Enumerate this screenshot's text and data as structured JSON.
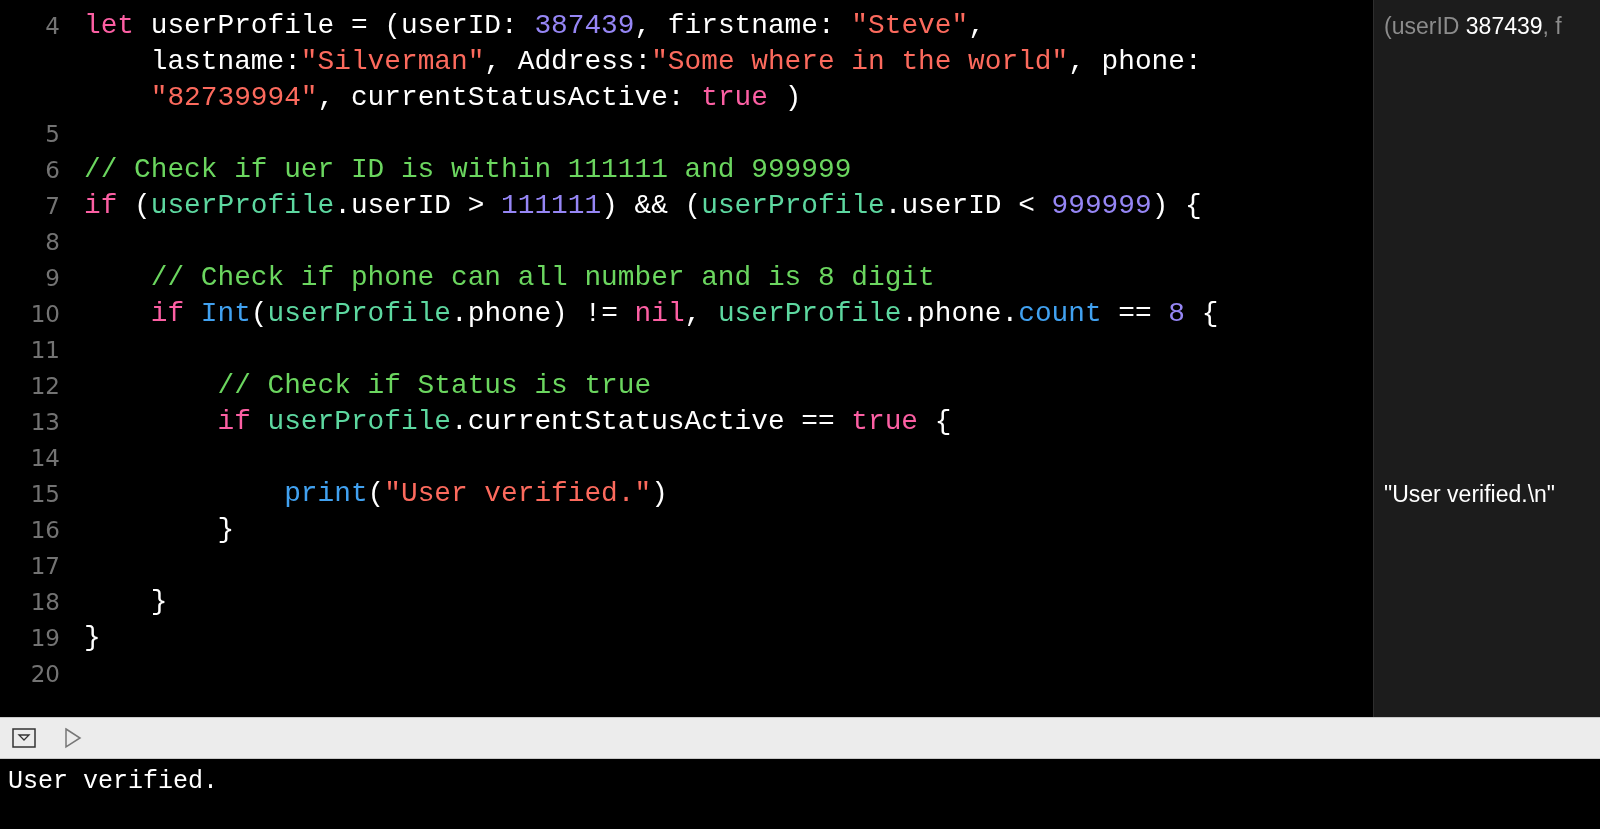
{
  "editor": {
    "lines": [
      {
        "number": "4",
        "tokens": [
          {
            "kind": "keyword",
            "text": "let"
          },
          {
            "kind": "plain",
            "text": " userProfile = (userID: "
          },
          {
            "kind": "number",
            "text": "387439"
          },
          {
            "kind": "plain",
            "text": ", firstname: "
          },
          {
            "kind": "string",
            "text": "\"Steve\""
          },
          {
            "kind": "plain",
            "text": ","
          }
        ],
        "result": [
          {
            "kind": "label",
            "text": "(userID "
          },
          {
            "kind": "value",
            "text": "387439"
          },
          {
            "kind": "label",
            "text": ", f"
          }
        ]
      },
      {
        "tokens": [
          {
            "kind": "plain",
            "text": "    lastname:"
          },
          {
            "kind": "string",
            "text": "\"Silverman\""
          },
          {
            "kind": "plain",
            "text": ", Address:"
          },
          {
            "kind": "string",
            "text": "\"Some where in the world\""
          },
          {
            "kind": "plain",
            "text": ", phone:"
          }
        ]
      },
      {
        "tokens": [
          {
            "kind": "string",
            "text": "    \"82739994\""
          },
          {
            "kind": "plain",
            "text": ", currentStatusActive: "
          },
          {
            "kind": "keyword",
            "text": "true"
          },
          {
            "kind": "plain",
            "text": " )"
          }
        ]
      },
      {
        "number": "5"
      },
      {
        "number": "6",
        "tokens": [
          {
            "kind": "comment",
            "text": "// Check if uer ID is within 111111 and 999999"
          }
        ]
      },
      {
        "number": "7",
        "tokens": [
          {
            "kind": "keyword",
            "text": "if"
          },
          {
            "kind": "plain",
            "text": " ("
          },
          {
            "kind": "ident",
            "text": "userProfile"
          },
          {
            "kind": "plain",
            "text": ".userID > "
          },
          {
            "kind": "number",
            "text": "111111"
          },
          {
            "kind": "plain",
            "text": ") && ("
          },
          {
            "kind": "ident",
            "text": "userProfile"
          },
          {
            "kind": "plain",
            "text": ".userID < "
          },
          {
            "kind": "number",
            "text": "999999"
          },
          {
            "kind": "plain",
            "text": ") {"
          }
        ]
      },
      {
        "number": "8"
      },
      {
        "number": "9",
        "tokens": [
          {
            "kind": "comment",
            "text": "    // Check if phone can all number and is 8 digit"
          }
        ]
      },
      {
        "number": "10",
        "tokens": [
          {
            "kind": "keyword",
            "text": "    if"
          },
          {
            "kind": "type",
            "text": " Int"
          },
          {
            "kind": "plain",
            "text": "("
          },
          {
            "kind": "ident",
            "text": "userProfile"
          },
          {
            "kind": "plain",
            "text": ".phone) != "
          },
          {
            "kind": "keyword",
            "text": "nil"
          },
          {
            "kind": "plain",
            "text": ", "
          },
          {
            "kind": "ident",
            "text": "userProfile"
          },
          {
            "kind": "plain",
            "text": ".phone."
          },
          {
            "kind": "type",
            "text": "count"
          },
          {
            "kind": "plain",
            "text": " == "
          },
          {
            "kind": "number",
            "text": "8"
          },
          {
            "kind": "plain",
            "text": " {"
          }
        ]
      },
      {
        "number": "11"
      },
      {
        "number": "12",
        "tokens": [
          {
            "kind": "comment",
            "text": "        // Check if Status is true"
          }
        ]
      },
      {
        "number": "13",
        "tokens": [
          {
            "kind": "keyword",
            "text": "        if"
          },
          {
            "kind": "ident",
            "text": " userProfile"
          },
          {
            "kind": "plain",
            "text": ".currentStatusActive == "
          },
          {
            "kind": "keyword",
            "text": "true"
          },
          {
            "kind": "plain",
            "text": " {"
          }
        ]
      },
      {
        "number": "14"
      },
      {
        "number": "15",
        "tokens": [
          {
            "kind": "type",
            "text": "            print"
          },
          {
            "kind": "plain",
            "text": "("
          },
          {
            "kind": "string",
            "text": "\"User verified.\""
          },
          {
            "kind": "plain",
            "text": ")"
          }
        ],
        "result": [
          {
            "kind": "value",
            "text": "\"User verified.\\n\""
          }
        ]
      },
      {
        "number": "16",
        "tokens": [
          {
            "kind": "plain",
            "text": "        }"
          }
        ]
      },
      {
        "number": "17"
      },
      {
        "number": "18",
        "tokens": [
          {
            "kind": "plain",
            "text": "    }"
          }
        ]
      },
      {
        "number": "19",
        "tokens": [
          {
            "kind": "plain",
            "text": "}"
          }
        ]
      },
      {
        "number": "20"
      }
    ]
  },
  "console": {
    "output": "User verified."
  }
}
